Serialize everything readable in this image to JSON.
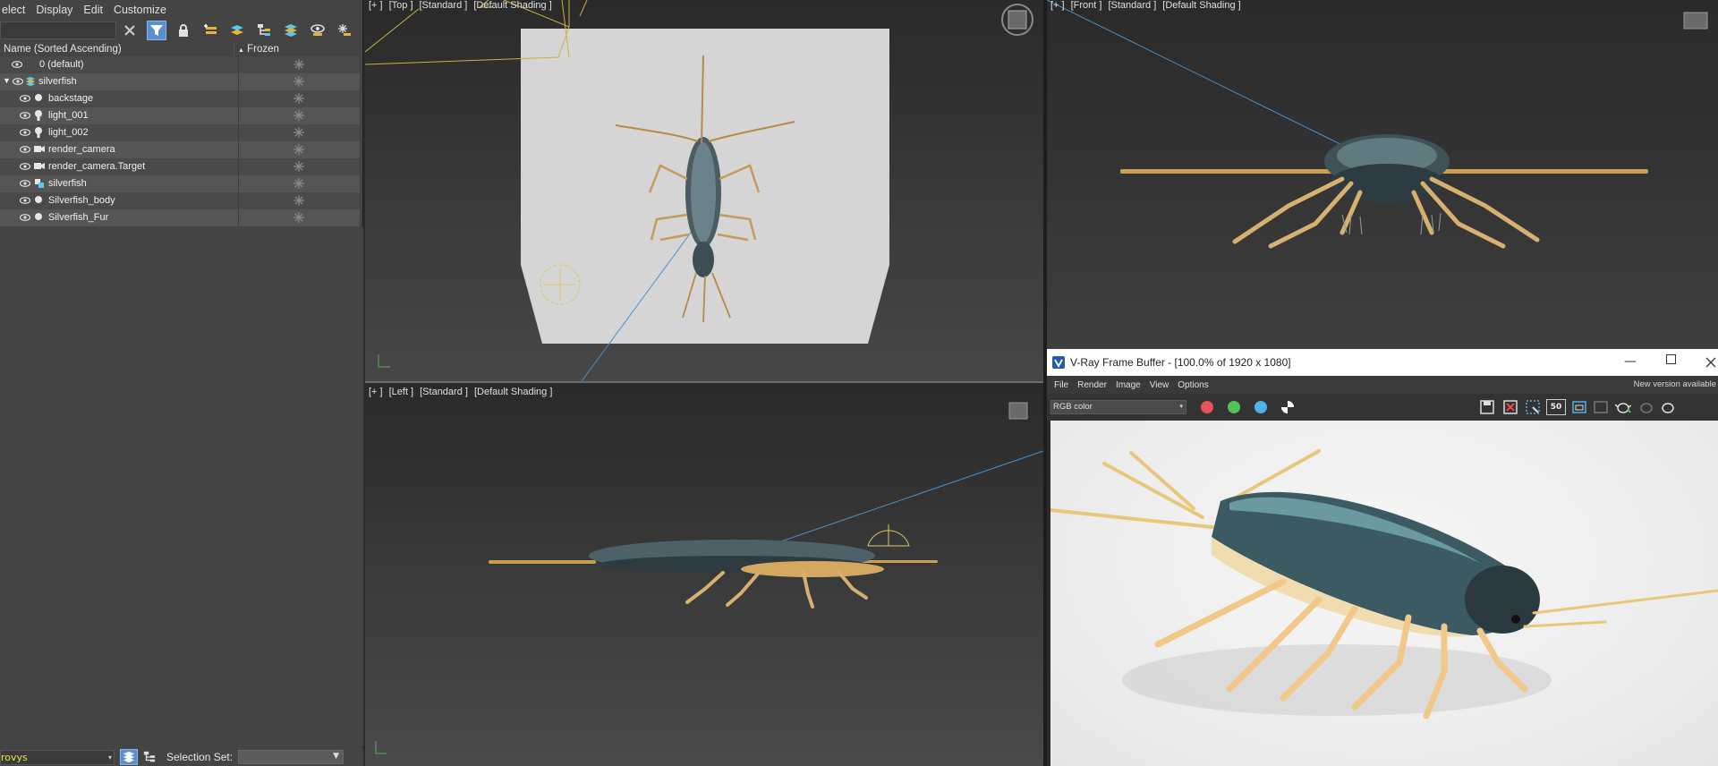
{
  "explorer": {
    "menu": [
      "elect",
      "Display",
      "Edit",
      "Customize"
    ],
    "columns": {
      "name": "Name (Sorted Ascending)",
      "frozen": "Frozen"
    },
    "rows": [
      {
        "label": "0 (default)",
        "type": "layer",
        "level": 0
      },
      {
        "label": "silverfish",
        "type": "layer-active",
        "level": 0
      },
      {
        "label": "backstage",
        "type": "geometry",
        "level": 1
      },
      {
        "label": "light_001",
        "type": "light",
        "level": 1
      },
      {
        "label": "light_002",
        "type": "light",
        "level": 1
      },
      {
        "label": "render_camera",
        "type": "camera",
        "level": 1
      },
      {
        "label": "render_camera.Target",
        "type": "camera",
        "level": 1
      },
      {
        "label": "silverfish",
        "type": "group",
        "level": 1
      },
      {
        "label": "Silverfish_body",
        "type": "geometry",
        "level": 1
      },
      {
        "label": "Silverfish_Fur",
        "type": "geometry",
        "level": 1
      }
    ],
    "bottom": {
      "input_value": "rovys",
      "selection_set_label": "Selection Set:",
      "selection_set_value": ""
    }
  },
  "viewports": {
    "top": {
      "plus": "[+ ]",
      "view": "[Top ]",
      "mode": "[Standard ]",
      "shading": "[Default Shading ]"
    },
    "front": {
      "plus": "[+ ]",
      "view": "[Front ]",
      "mode": "[Standard ]",
      "shading": "[Default Shading ]"
    },
    "left": {
      "plus": "[+ ]",
      "view": "[Left ]",
      "mode": "[Standard ]",
      "shading": "[Default Shading ]"
    }
  },
  "vfb": {
    "title": "V-Ray Frame Buffer - [100.0% of 1920 x 1080]",
    "menu": [
      "File",
      "Render",
      "Image",
      "View",
      "Options"
    ],
    "notice": "New version available",
    "channel": "RGB color",
    "zoom_label": "50",
    "colors": {
      "red": "#e8525a",
      "green": "#4fc35a",
      "blue": "#4fb3e8"
    }
  }
}
